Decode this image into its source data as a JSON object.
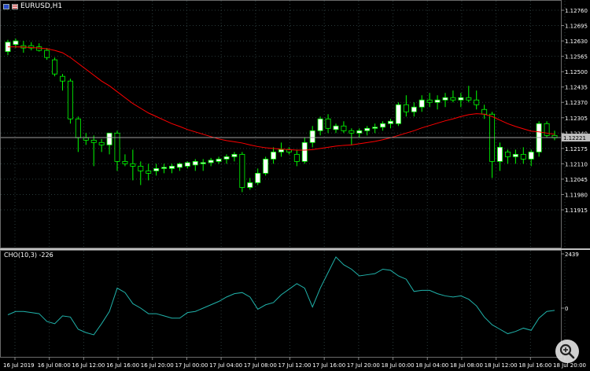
{
  "symbol": {
    "title": "EURUSD,H1"
  },
  "main_axis": {
    "labels": [
      "1.12760",
      "1.12695",
      "1.12630",
      "1.12565",
      "1.12500",
      "1.12435",
      "1.12370",
      "1.12305",
      "1.12240",
      "1.12175",
      "1.12110",
      "1.12045",
      "1.11980",
      "1.11915"
    ],
    "current_price": "1.12221"
  },
  "sub_window": {
    "title": "CHO(10,3) -226",
    "axis_labels": [
      "2439",
      "0"
    ]
  },
  "time_axis": {
    "labels": [
      "16 Jul 2019",
      "16 Jul 08:00",
      "16 Jul 12:00",
      "16 Jul 16:00",
      "16 Jul 20:00",
      "17 Jul 00:00",
      "17 Jul 04:00",
      "17 Jul 08:00",
      "17 Jul 12:00",
      "17 Jul 16:00",
      "17 Jul 20:00",
      "18 Jul 00:00",
      "18 Jul 04:00",
      "18 Jul 08:00",
      "18 Jul 12:00",
      "18 Jul 16:00",
      "18 Jul 20:00"
    ]
  },
  "colors": {
    "bull_body": "#ffffff",
    "bear_body": "#000000",
    "wick": "#00ff00",
    "ma": "#ff0000",
    "oscillator": "#20b2aa",
    "grid": "#2a3a3a",
    "price_line": "#a0a0a0"
  },
  "chart_data": [
    {
      "type": "candlestick",
      "title": "EURUSD,H1",
      "ylim": [
        1.1185,
        1.1279
      ],
      "candles": [
        {
          "o": 1.12585,
          "h": 1.12635,
          "l": 1.1257,
          "c": 1.12625
        },
        {
          "o": 1.12615,
          "h": 1.1264,
          "l": 1.126,
          "c": 1.1263
        },
        {
          "o": 1.1261,
          "h": 1.1263,
          "l": 1.1258,
          "c": 1.126
        },
        {
          "o": 1.1261,
          "h": 1.12625,
          "l": 1.1259,
          "c": 1.126
        },
        {
          "o": 1.12605,
          "h": 1.1262,
          "l": 1.12585,
          "c": 1.1259
        },
        {
          "o": 1.1259,
          "h": 1.126,
          "l": 1.1255,
          "c": 1.1256
        },
        {
          "o": 1.1255,
          "h": 1.1256,
          "l": 1.1248,
          "c": 1.1249
        },
        {
          "o": 1.1248,
          "h": 1.1249,
          "l": 1.1242,
          "c": 1.1246
        },
        {
          "o": 1.1246,
          "h": 1.1247,
          "l": 1.1228,
          "c": 1.123
        },
        {
          "o": 1.123,
          "h": 1.1231,
          "l": 1.1216,
          "c": 1.1222
        },
        {
          "o": 1.1222,
          "h": 1.1224,
          "l": 1.1219,
          "c": 1.1221
        },
        {
          "o": 1.1221,
          "h": 1.1223,
          "l": 1.121,
          "c": 1.122
        },
        {
          "o": 1.122,
          "h": 1.12215,
          "l": 1.1216,
          "c": 1.1219
        },
        {
          "o": 1.1219,
          "h": 1.1224,
          "l": 1.1215,
          "c": 1.1224
        },
        {
          "o": 1.1224,
          "h": 1.1225,
          "l": 1.1208,
          "c": 1.1212
        },
        {
          "o": 1.1212,
          "h": 1.1215,
          "l": 1.121,
          "c": 1.1211
        },
        {
          "o": 1.1211,
          "h": 1.1217,
          "l": 1.1204,
          "c": 1.121
        },
        {
          "o": 1.121,
          "h": 1.1212,
          "l": 1.1202,
          "c": 1.1208
        },
        {
          "o": 1.1208,
          "h": 1.1211,
          "l": 1.1204,
          "c": 1.1207
        },
        {
          "o": 1.1208,
          "h": 1.1211,
          "l": 1.1206,
          "c": 1.1209
        },
        {
          "o": 1.1209,
          "h": 1.1211,
          "l": 1.1207,
          "c": 1.12095
        },
        {
          "o": 1.1209,
          "h": 1.1211,
          "l": 1.1207,
          "c": 1.121
        },
        {
          "o": 1.12095,
          "h": 1.12115,
          "l": 1.1208,
          "c": 1.1211
        },
        {
          "o": 1.121,
          "h": 1.1212,
          "l": 1.1209,
          "c": 1.12115
        },
        {
          "o": 1.12105,
          "h": 1.1213,
          "l": 1.1208,
          "c": 1.1212
        },
        {
          "o": 1.1211,
          "h": 1.1213,
          "l": 1.1208,
          "c": 1.12115
        },
        {
          "o": 1.12115,
          "h": 1.12135,
          "l": 1.121,
          "c": 1.12125
        },
        {
          "o": 1.1212,
          "h": 1.1214,
          "l": 1.1211,
          "c": 1.1213
        },
        {
          "o": 1.1213,
          "h": 1.1215,
          "l": 1.1211,
          "c": 1.1214
        },
        {
          "o": 1.1214,
          "h": 1.1216,
          "l": 1.1212,
          "c": 1.1215
        },
        {
          "o": 1.1215,
          "h": 1.1216,
          "l": 1.1199,
          "c": 1.1201
        },
        {
          "o": 1.1201,
          "h": 1.1205,
          "l": 1.12,
          "c": 1.1203
        },
        {
          "o": 1.1203,
          "h": 1.1209,
          "l": 1.1202,
          "c": 1.1207
        },
        {
          "o": 1.1207,
          "h": 1.1214,
          "l": 1.1206,
          "c": 1.1213
        },
        {
          "o": 1.1213,
          "h": 1.1218,
          "l": 1.1211,
          "c": 1.1216
        },
        {
          "o": 1.1216,
          "h": 1.122,
          "l": 1.1214,
          "c": 1.1217
        },
        {
          "o": 1.1217,
          "h": 1.1218,
          "l": 1.1215,
          "c": 1.1216
        },
        {
          "o": 1.1215,
          "h": 1.1217,
          "l": 1.121,
          "c": 1.1212
        },
        {
          "o": 1.1212,
          "h": 1.1222,
          "l": 1.1211,
          "c": 1.122
        },
        {
          "o": 1.122,
          "h": 1.1227,
          "l": 1.1218,
          "c": 1.1225
        },
        {
          "o": 1.1225,
          "h": 1.1231,
          "l": 1.1223,
          "c": 1.123
        },
        {
          "o": 1.123,
          "h": 1.1232,
          "l": 1.1224,
          "c": 1.1226
        },
        {
          "o": 1.12255,
          "h": 1.1228,
          "l": 1.1224,
          "c": 1.1227
        },
        {
          "o": 1.1227,
          "h": 1.1229,
          "l": 1.1224,
          "c": 1.1225
        },
        {
          "o": 1.1225,
          "h": 1.1226,
          "l": 1.1219,
          "c": 1.1224
        },
        {
          "o": 1.1224,
          "h": 1.1226,
          "l": 1.1222,
          "c": 1.1225
        },
        {
          "o": 1.1225,
          "h": 1.1227,
          "l": 1.1223,
          "c": 1.1226
        },
        {
          "o": 1.1226,
          "h": 1.1228,
          "l": 1.1224,
          "c": 1.12265
        },
        {
          "o": 1.12265,
          "h": 1.1229,
          "l": 1.1225,
          "c": 1.1228
        },
        {
          "o": 1.1228,
          "h": 1.123,
          "l": 1.1226,
          "c": 1.1229
        },
        {
          "o": 1.1228,
          "h": 1.1237,
          "l": 1.1227,
          "c": 1.1236
        },
        {
          "o": 1.1236,
          "h": 1.124,
          "l": 1.1231,
          "c": 1.1233
        },
        {
          "o": 1.1233,
          "h": 1.1237,
          "l": 1.1231,
          "c": 1.1235
        },
        {
          "o": 1.1235,
          "h": 1.124,
          "l": 1.1233,
          "c": 1.1238
        },
        {
          "o": 1.1238,
          "h": 1.1241,
          "l": 1.1235,
          "c": 1.1237
        },
        {
          "o": 1.1237,
          "h": 1.124,
          "l": 1.1234,
          "c": 1.1238
        },
        {
          "o": 1.1238,
          "h": 1.1241,
          "l": 1.1235,
          "c": 1.1239
        },
        {
          "o": 1.1239,
          "h": 1.1242,
          "l": 1.1237,
          "c": 1.1238
        },
        {
          "o": 1.1238,
          "h": 1.1241,
          "l": 1.1235,
          "c": 1.1239
        },
        {
          "o": 1.1239,
          "h": 1.1244,
          "l": 1.1237,
          "c": 1.1238
        },
        {
          "o": 1.1238,
          "h": 1.1242,
          "l": 1.1234,
          "c": 1.1236
        },
        {
          "o": 1.1234,
          "h": 1.1236,
          "l": 1.123,
          "c": 1.1232
        },
        {
          "o": 1.1232,
          "h": 1.1233,
          "l": 1.1205,
          "c": 1.1212
        },
        {
          "o": 1.1212,
          "h": 1.122,
          "l": 1.1208,
          "c": 1.1218
        },
        {
          "o": 1.1216,
          "h": 1.1217,
          "l": 1.1211,
          "c": 1.1214
        },
        {
          "o": 1.1214,
          "h": 1.1217,
          "l": 1.1211,
          "c": 1.1215
        },
        {
          "o": 1.1215,
          "h": 1.1218,
          "l": 1.1211,
          "c": 1.1213
        },
        {
          "o": 1.1213,
          "h": 1.1217,
          "l": 1.121,
          "c": 1.1216
        },
        {
          "o": 1.1216,
          "h": 1.1229,
          "l": 1.1214,
          "c": 1.1228
        },
        {
          "o": 1.1228,
          "h": 1.1229,
          "l": 1.1222,
          "c": 1.1223
        },
        {
          "o": 1.1223,
          "h": 1.1225,
          "l": 1.1221,
          "c": 1.1222
        }
      ],
      "ma": [
        1.12605,
        1.12605,
        1.12604,
        1.12602,
        1.126,
        1.12597,
        1.1259,
        1.1258,
        1.1256,
        1.12535,
        1.1251,
        1.12485,
        1.1246,
        1.1244,
        1.12415,
        1.1239,
        1.12365,
        1.12345,
        1.12325,
        1.1231,
        1.12295,
        1.1228,
        1.12268,
        1.12255,
        1.12245,
        1.12235,
        1.12225,
        1.12215,
        1.12208,
        1.12203,
        1.12198,
        1.1219,
        1.12183,
        1.12178,
        1.12175,
        1.12172,
        1.1217,
        1.12168,
        1.12168,
        1.1217,
        1.12175,
        1.1218,
        1.12185,
        1.12188,
        1.1219,
        1.12195,
        1.122,
        1.12205,
        1.12212,
        1.1222,
        1.1223,
        1.1224,
        1.1225,
        1.12262,
        1.12272,
        1.12282,
        1.12292,
        1.123,
        1.1231,
        1.12318,
        1.12322,
        1.1232,
        1.1231,
        1.12295,
        1.1228,
        1.12268,
        1.12258,
        1.12248,
        1.12245,
        1.1224,
        1.12235
      ]
    },
    {
      "type": "line",
      "title": "CHO(10,3) -226",
      "ylim": [
        -1300,
        2439
      ],
      "values": [
        -300,
        -150,
        -150,
        -200,
        -250,
        -600,
        -700,
        -350,
        -400,
        -950,
        -1100,
        -1200,
        -700,
        -150,
        900,
        700,
        200,
        0,
        -250,
        -250,
        -350,
        -450,
        -450,
        -200,
        -150,
        0,
        150,
        300,
        500,
        650,
        700,
        500,
        -50,
        150,
        250,
        600,
        850,
        1100,
        900,
        50,
        900,
        1600,
        2300,
        1950,
        1750,
        1450,
        1500,
        1550,
        1750,
        1700,
        1450,
        1300,
        750,
        800,
        800,
        650,
        550,
        500,
        550,
        400,
        100,
        -400,
        -750,
        -950,
        -1150,
        -1050,
        -900,
        -1000,
        -450,
        -150,
        -100
      ]
    }
  ]
}
